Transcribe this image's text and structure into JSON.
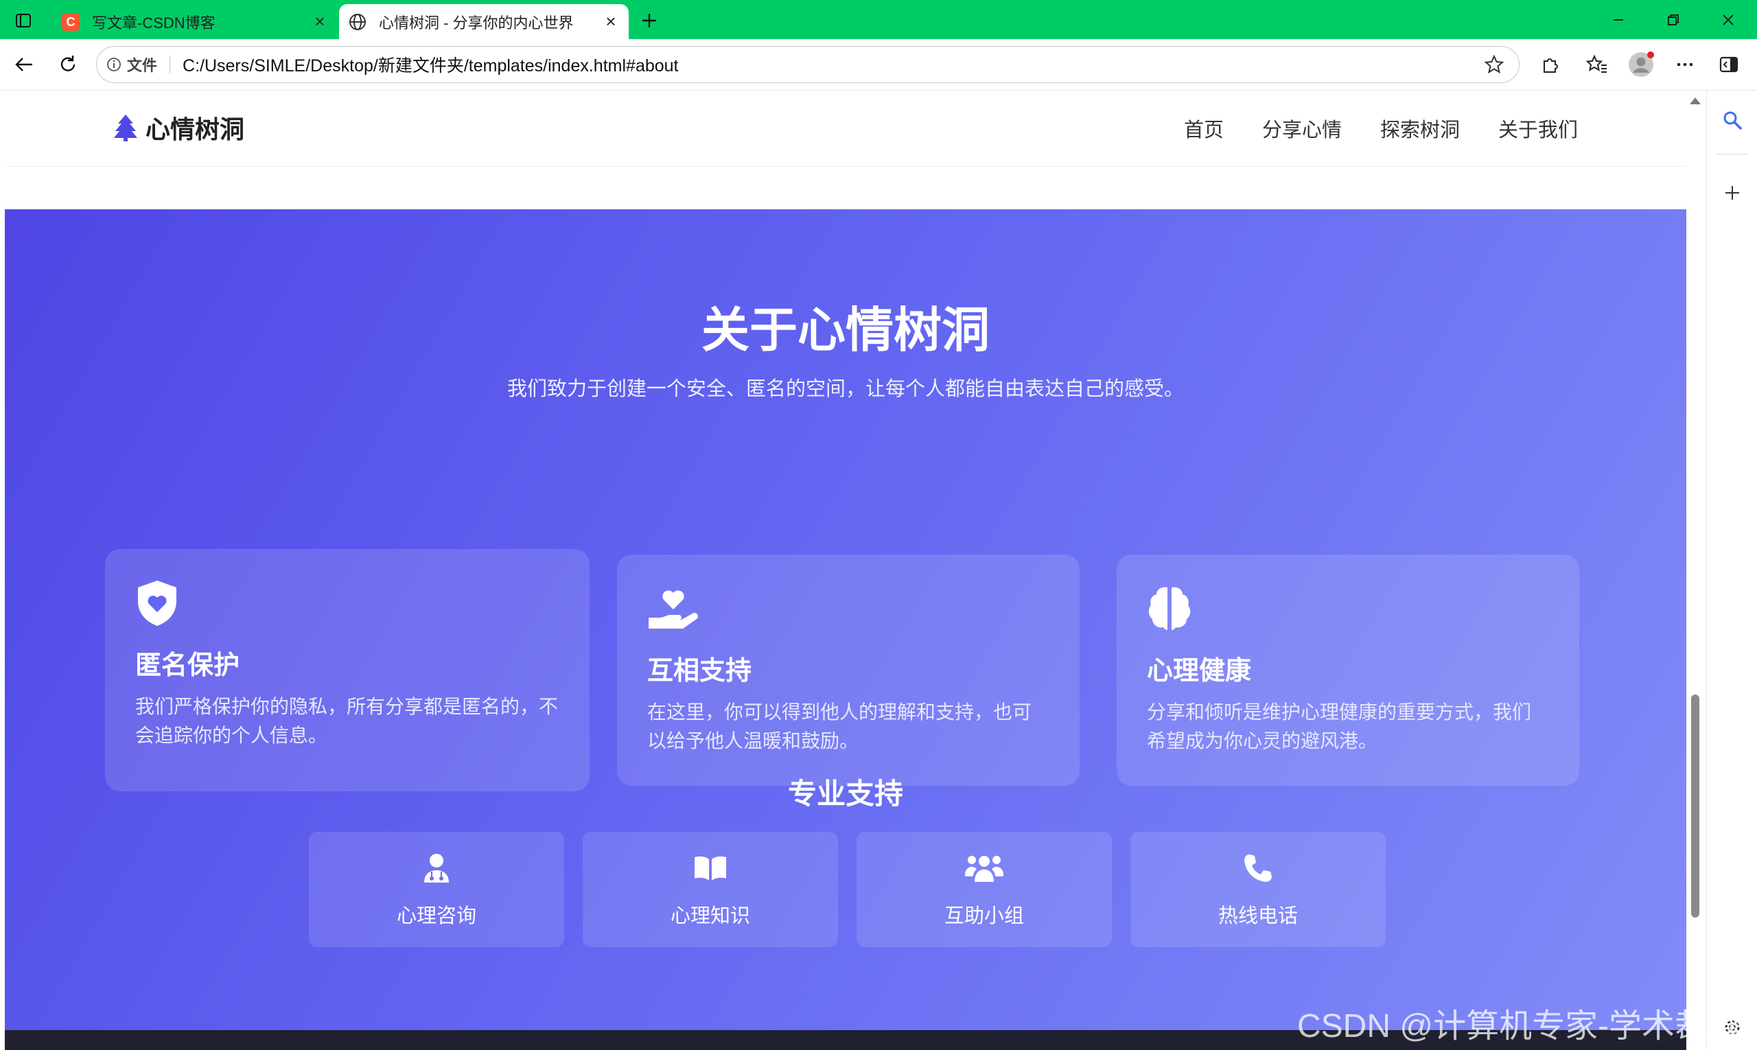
{
  "browser": {
    "tabs": [
      {
        "title": "写文章-CSDN博客",
        "favicon": "csdn-c-icon",
        "active": false
      },
      {
        "title": "心情树洞 - 分享你的内心世界",
        "favicon": "globe-icon",
        "active": true
      }
    ],
    "address": {
      "label": "文件",
      "url": "C:/Users/SIMLE/Desktop/新建文件夹/templates/index.html#about"
    },
    "colors": {
      "tabbar": "#00cc66"
    }
  },
  "site": {
    "logo_text": "心情树洞",
    "logo_icon": "tree-icon",
    "nav": [
      "首页",
      "分享心情",
      "探索树洞",
      "关于我们"
    ]
  },
  "about": {
    "title": "关于心情树洞",
    "subtitle": "我们致力于创建一个安全、匿名的空间，让每个人都能自由表达自己的感受。",
    "cards": [
      {
        "icon": "shield-heart-icon",
        "title": "匿名保护",
        "desc": "我们严格保护你的隐私，所有分享都是匿名的，不会追踪你的个人信息。"
      },
      {
        "icon": "hand-holding-heart-icon",
        "title": "互相支持",
        "desc": "在这里，你可以得到他人的理解和支持，也可以给予他人温暖和鼓励。"
      },
      {
        "icon": "brain-icon",
        "title": "心理健康",
        "desc": "分享和倾听是维护心理健康的重要方式，我们希望成为你心灵的避风港。"
      }
    ],
    "pro_title": "专业支持",
    "pro_items": [
      {
        "icon": "user-doctor-icon",
        "label": "心理咨询"
      },
      {
        "icon": "book-open-icon",
        "label": "心理知识"
      },
      {
        "icon": "users-icon",
        "label": "互助小组"
      },
      {
        "icon": "phone-icon",
        "label": "热线电话"
      }
    ],
    "colors": {
      "gradient_start": "#4f46e5",
      "gradient_end": "#818cf8"
    }
  },
  "watermark": "CSDN @计算机专家-学术裁缝"
}
